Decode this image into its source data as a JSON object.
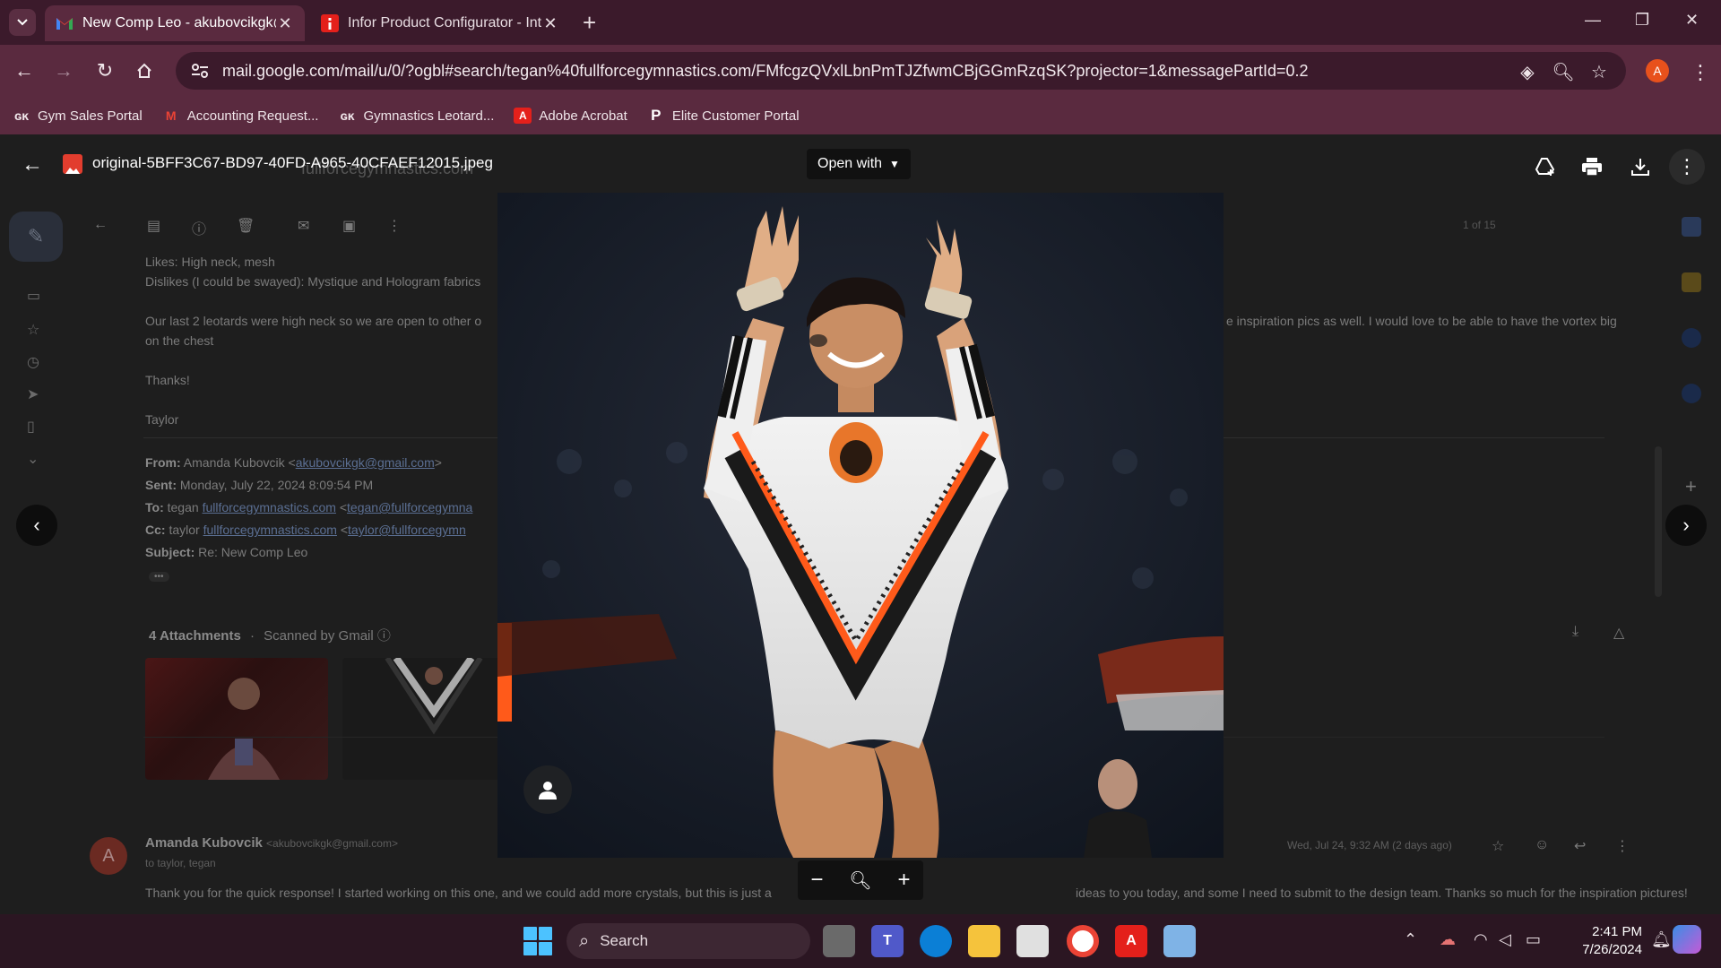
{
  "browser": {
    "tabs": [
      {
        "title": "New Comp Leo - akubovcikgk@",
        "active": true,
        "icon": "gmail-icon"
      },
      {
        "title": "Infor Product Configurator - Int",
        "active": false,
        "icon": "infor-icon"
      }
    ],
    "new_tab_label": "+",
    "url": "mail.google.com/mail/u/0/?ogbl#search/tegan%40fullforcegymnastics.com/FMfcgzQVxlLbnPmTJZfwmCBjGGmRzqSK?projector=1&messagePartId=0.2",
    "profile_initial": "A",
    "bookmarks": [
      {
        "label": "Gym Sales Portal",
        "icon": "gk-icon"
      },
      {
        "label": "Accounting Request...",
        "icon": "gmail-icon"
      },
      {
        "label": "Gymnastics Leotard...",
        "icon": "gk-icon"
      },
      {
        "label": "Adobe Acrobat",
        "icon": "acrobat-icon"
      },
      {
        "label": "Elite Customer Portal",
        "icon": "p-icon"
      }
    ]
  },
  "viewer": {
    "filename": "original-5BFF3C67-BD97-40FD-A965-40CFAEF12015.jpeg",
    "open_with_label": "Open with"
  },
  "email": {
    "line_likes": "Likes: High neck, mesh",
    "line_dislikes": "Dislikes (I could be swayed): Mystique and Hologram fabrics",
    "para_start": "Our last 2 leotards were high neck so we are open to other o",
    "para_end": "e inspiration pics as well. I would love to be able to have the vortex big",
    "para_cont": "on the chest",
    "thanks": "Thanks!",
    "signature": "Taylor",
    "from_label": "From:",
    "from_value": "Amanda Kubovcik <",
    "from_email": "akubovcikgk@gmail.com",
    "from_close": ">",
    "sent_label": "Sent:",
    "sent_value": "Monday, July 22, 2024 8:09:54 PM",
    "to_label": "To:",
    "to_value": "tegan",
    "to_link": "fullforcegymnastics.com",
    "to_value2": "<",
    "to_link2": "tegan@fullforcegymna",
    "cc_label": "Cc:",
    "cc_value": "taylor",
    "cc_link": "fullforcegymnastics.com",
    "cc_value2": "<",
    "cc_link2": "taylor@fullforcegymn",
    "subject_label": "Subject:",
    "subject_value": "Re: New Comp Leo",
    "ellipsis": "•••",
    "attachments_label": "4 Attachments",
    "scanned_label": "Scanned by Gmail",
    "pager": "1 of 15",
    "reply_sender": "Amanda Kubovcik",
    "reply_sender_email": "<akubovcikgk@gmail.com>",
    "reply_to": "to taylor, tegan",
    "reply_date": "Wed, Jul 24, 9:32 AM (2 days ago)",
    "reply_body_start": "Thank you for the quick response! I started working on this one, and we could add more crystals, but this is just a",
    "reply_body_end": "ideas to you today, and some I need to submit to the design team. Thanks so much for the inspiration pictures!",
    "avatar_initial": "A",
    "search_fragment": "fullforcegymnastics.com"
  },
  "taskbar": {
    "search_label": "Search",
    "time": "2:41 PM",
    "date": "7/26/2024"
  },
  "colors": {
    "chrome_dark": "#3b1a2b",
    "chrome_mid": "#5a2a3f",
    "accent_blue": "#4cc2ff",
    "gmail_red": "#ea4335",
    "acrobat_red": "#e4201b",
    "profile_orange": "#e8511c"
  }
}
